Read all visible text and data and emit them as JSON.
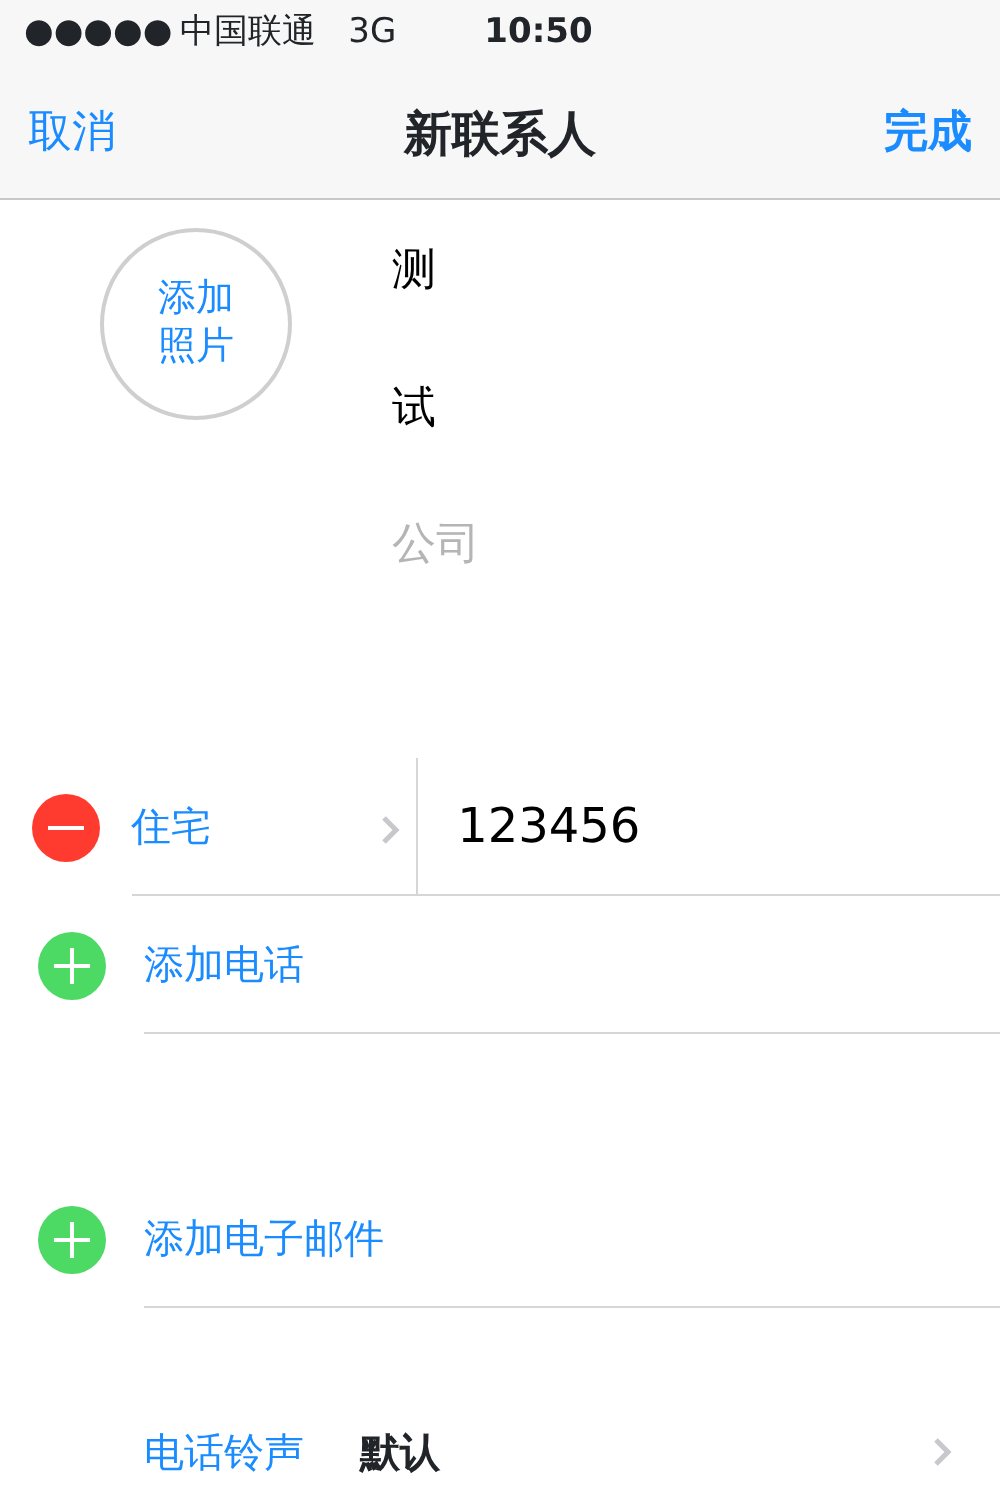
{
  "status_bar": {
    "signal": "●●●●●",
    "carrier": "中国联通",
    "network": "3G",
    "time": "10:50"
  },
  "nav": {
    "cancel": "取消",
    "title": "新联系人",
    "done": "完成"
  },
  "photo": {
    "lines": [
      "添加",
      "照片"
    ]
  },
  "name_fields": [
    {
      "value": "测"
    },
    {
      "value": "试"
    },
    {
      "placeholder": "公司"
    }
  ],
  "sections": [
    {
      "rows": [
        {
          "kind": "phone",
          "label": "住宅",
          "value": "123456"
        },
        {
          "kind": "add",
          "label": "添加电话"
        }
      ]
    },
    {
      "rows": [
        {
          "kind": "add",
          "label": "添加电子邮件"
        }
      ]
    },
    {
      "rows": [
        {
          "kind": "setting",
          "label": "电话铃声",
          "value": "默认"
        }
      ]
    }
  ]
}
